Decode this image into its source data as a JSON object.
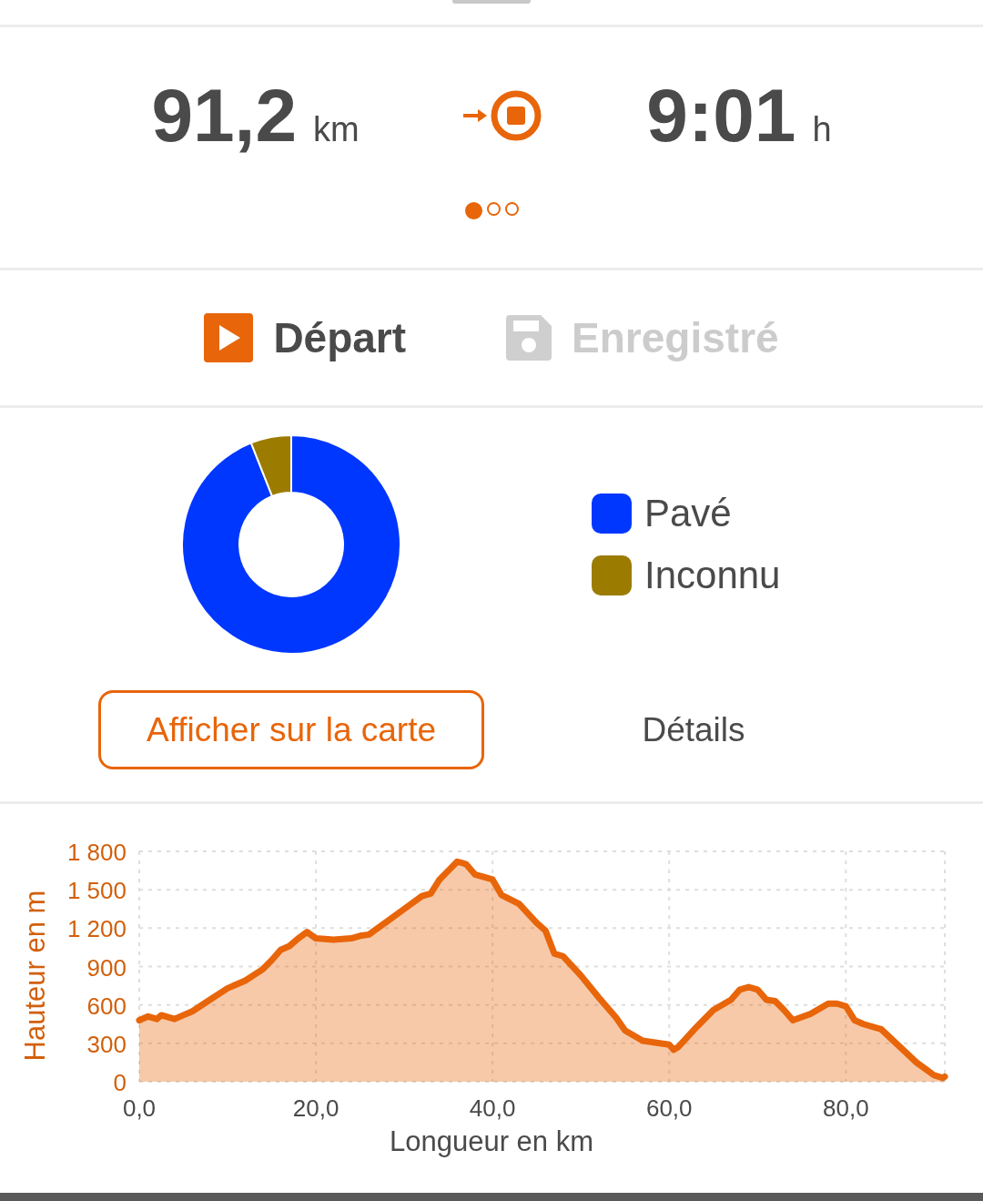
{
  "summary": {
    "distance": "91,2",
    "distance_unit": "km",
    "duration": "9:01",
    "duration_unit": "h"
  },
  "pager": [
    {
      "selected": true
    },
    {
      "selected": false
    },
    {
      "selected": false
    }
  ],
  "tabs": [
    {
      "label": "Départ",
      "kind": "start",
      "selected": true
    },
    {
      "label": "Enregistré",
      "kind": "saved",
      "selected": false
    }
  ],
  "surface": {
    "chart_data": {
      "type": "donut",
      "categories": [
        "Pavé",
        "Inconnu"
      ],
      "series": [
        {
          "values": [
            94,
            6
          ]
        }
      ],
      "colors": [
        "#0037ff",
        "#9c7c00"
      ]
    }
  },
  "buttons": [
    {
      "label": "Afficher sur la carte",
      "kind": "outlined"
    },
    {
      "label": "Détails",
      "kind": "text"
    }
  ],
  "elevation": {
    "chart_data": {
      "type": "area",
      "grid": true,
      "xlabel": "Longueur en km",
      "ylabel": "Hauteur en m",
      "xlim": [
        0,
        91.2
      ],
      "ylim": [
        0,
        1800
      ],
      "xticks": [
        {
          "value": 0,
          "label": "0,0"
        },
        {
          "value": 20,
          "label": "20,0"
        },
        {
          "value": 40,
          "label": "40,0"
        },
        {
          "value": 60,
          "label": "60,0"
        },
        {
          "value": 80,
          "label": "80,0"
        }
      ],
      "yticks": [
        {
          "value": 0,
          "label": "0"
        },
        {
          "value": 300,
          "label": "300"
        },
        {
          "value": 600,
          "label": "600"
        },
        {
          "value": 900,
          "label": "900"
        },
        {
          "value": 1200,
          "label": "1 200"
        },
        {
          "value": 1500,
          "label": "1 500"
        },
        {
          "value": 1800,
          "label": "1 800"
        }
      ],
      "x": [
        0,
        1,
        2,
        2.5,
        4,
        5,
        6,
        8,
        10,
        12,
        14,
        15,
        16,
        17,
        18,
        19,
        20,
        22,
        24,
        25,
        26,
        28,
        30,
        32,
        33,
        34,
        35,
        36,
        37,
        38,
        39,
        40,
        41,
        43,
        45,
        46,
        47,
        48,
        50,
        52,
        54,
        55,
        57,
        60,
        60.5,
        61,
        63,
        65,
        67,
        68,
        69,
        70,
        71,
        72,
        73,
        74,
        76,
        78,
        79,
        80,
        81,
        82,
        84,
        86,
        88,
        89,
        90,
        91,
        91.2
      ],
      "series": [
        {
          "color": "#e8650a",
          "values": [
            480,
            510,
            490,
            520,
            490,
            520,
            550,
            640,
            730,
            790,
            880,
            950,
            1030,
            1060,
            1120,
            1170,
            1120,
            1110,
            1120,
            1140,
            1150,
            1250,
            1350,
            1450,
            1470,
            1580,
            1650,
            1720,
            1700,
            1620,
            1600,
            1580,
            1460,
            1390,
            1240,
            1180,
            1000,
            980,
            830,
            660,
            500,
            400,
            320,
            290,
            250,
            270,
            420,
            560,
            640,
            720,
            740,
            720,
            640,
            630,
            560,
            480,
            530,
            610,
            610,
            590,
            480,
            450,
            410,
            280,
            150,
            100,
            50,
            30,
            40
          ]
        }
      ]
    }
  }
}
